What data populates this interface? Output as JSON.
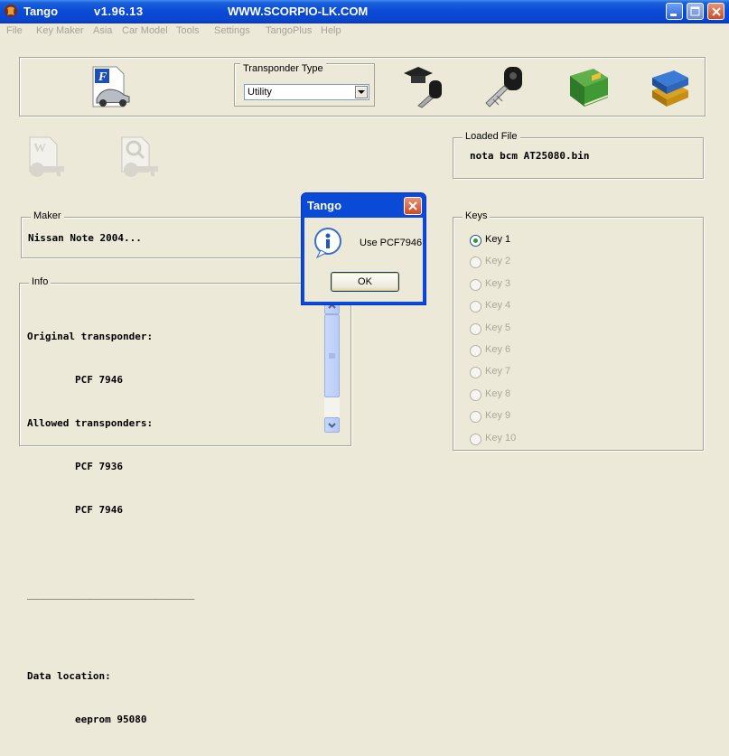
{
  "window": {
    "app_name": "Tango",
    "version": "v1.96.13",
    "website": "WWW.SCORPIO-LK.COM"
  },
  "menu": [
    {
      "label": "File"
    },
    {
      "label": "Key Maker"
    },
    {
      "label": "Asia"
    },
    {
      "label": "Car Model"
    },
    {
      "label": "Tools"
    },
    {
      "label": "Settings"
    },
    {
      "label": "TangoPlus"
    },
    {
      "label": "Help"
    }
  ],
  "toolbar": {
    "transponder_type_label": "Transponder Type",
    "transponder_type_value": "Utility",
    "icons": [
      "car-file-icon",
      "graduation-key-icon",
      "key-fob-icon",
      "green-book-icon",
      "books-stack-icon"
    ]
  },
  "loaded_file": {
    "label": "Loaded File",
    "value": "nota bcm AT25080.bin"
  },
  "maker": {
    "label": "Maker",
    "value": "Nissan Note 2004..."
  },
  "info": {
    "label": "Info",
    "lines": [
      "Original transponder:",
      "        PCF 7946",
      "Allowed transponders:",
      "        PCF 7936",
      "        PCF 7946",
      "",
      "____________________________",
      "",
      "Data location:",
      "        eeprom 95080"
    ]
  },
  "keys": {
    "label": "Keys",
    "items": [
      {
        "label": "Key 1",
        "selected": true,
        "enabled": true
      },
      {
        "label": "Key 2",
        "selected": false,
        "enabled": false
      },
      {
        "label": "Key 3",
        "selected": false,
        "enabled": false
      },
      {
        "label": "Key 4",
        "selected": false,
        "enabled": false
      },
      {
        "label": "Key 5",
        "selected": false,
        "enabled": false
      },
      {
        "label": "Key 6",
        "selected": false,
        "enabled": false
      },
      {
        "label": "Key 7",
        "selected": false,
        "enabled": false
      },
      {
        "label": "Key 8",
        "selected": false,
        "enabled": false
      },
      {
        "label": "Key 9",
        "selected": false,
        "enabled": false
      },
      {
        "label": "Key 10",
        "selected": false,
        "enabled": false
      }
    ]
  },
  "dialog": {
    "title": "Tango",
    "message": "Use PCF7946",
    "ok_label": "OK",
    "icon": "info-icon"
  },
  "colors": {
    "titlebar": "#0a4ad6",
    "window_bg": "#ece9d8",
    "disabled_text": "#aca899"
  }
}
